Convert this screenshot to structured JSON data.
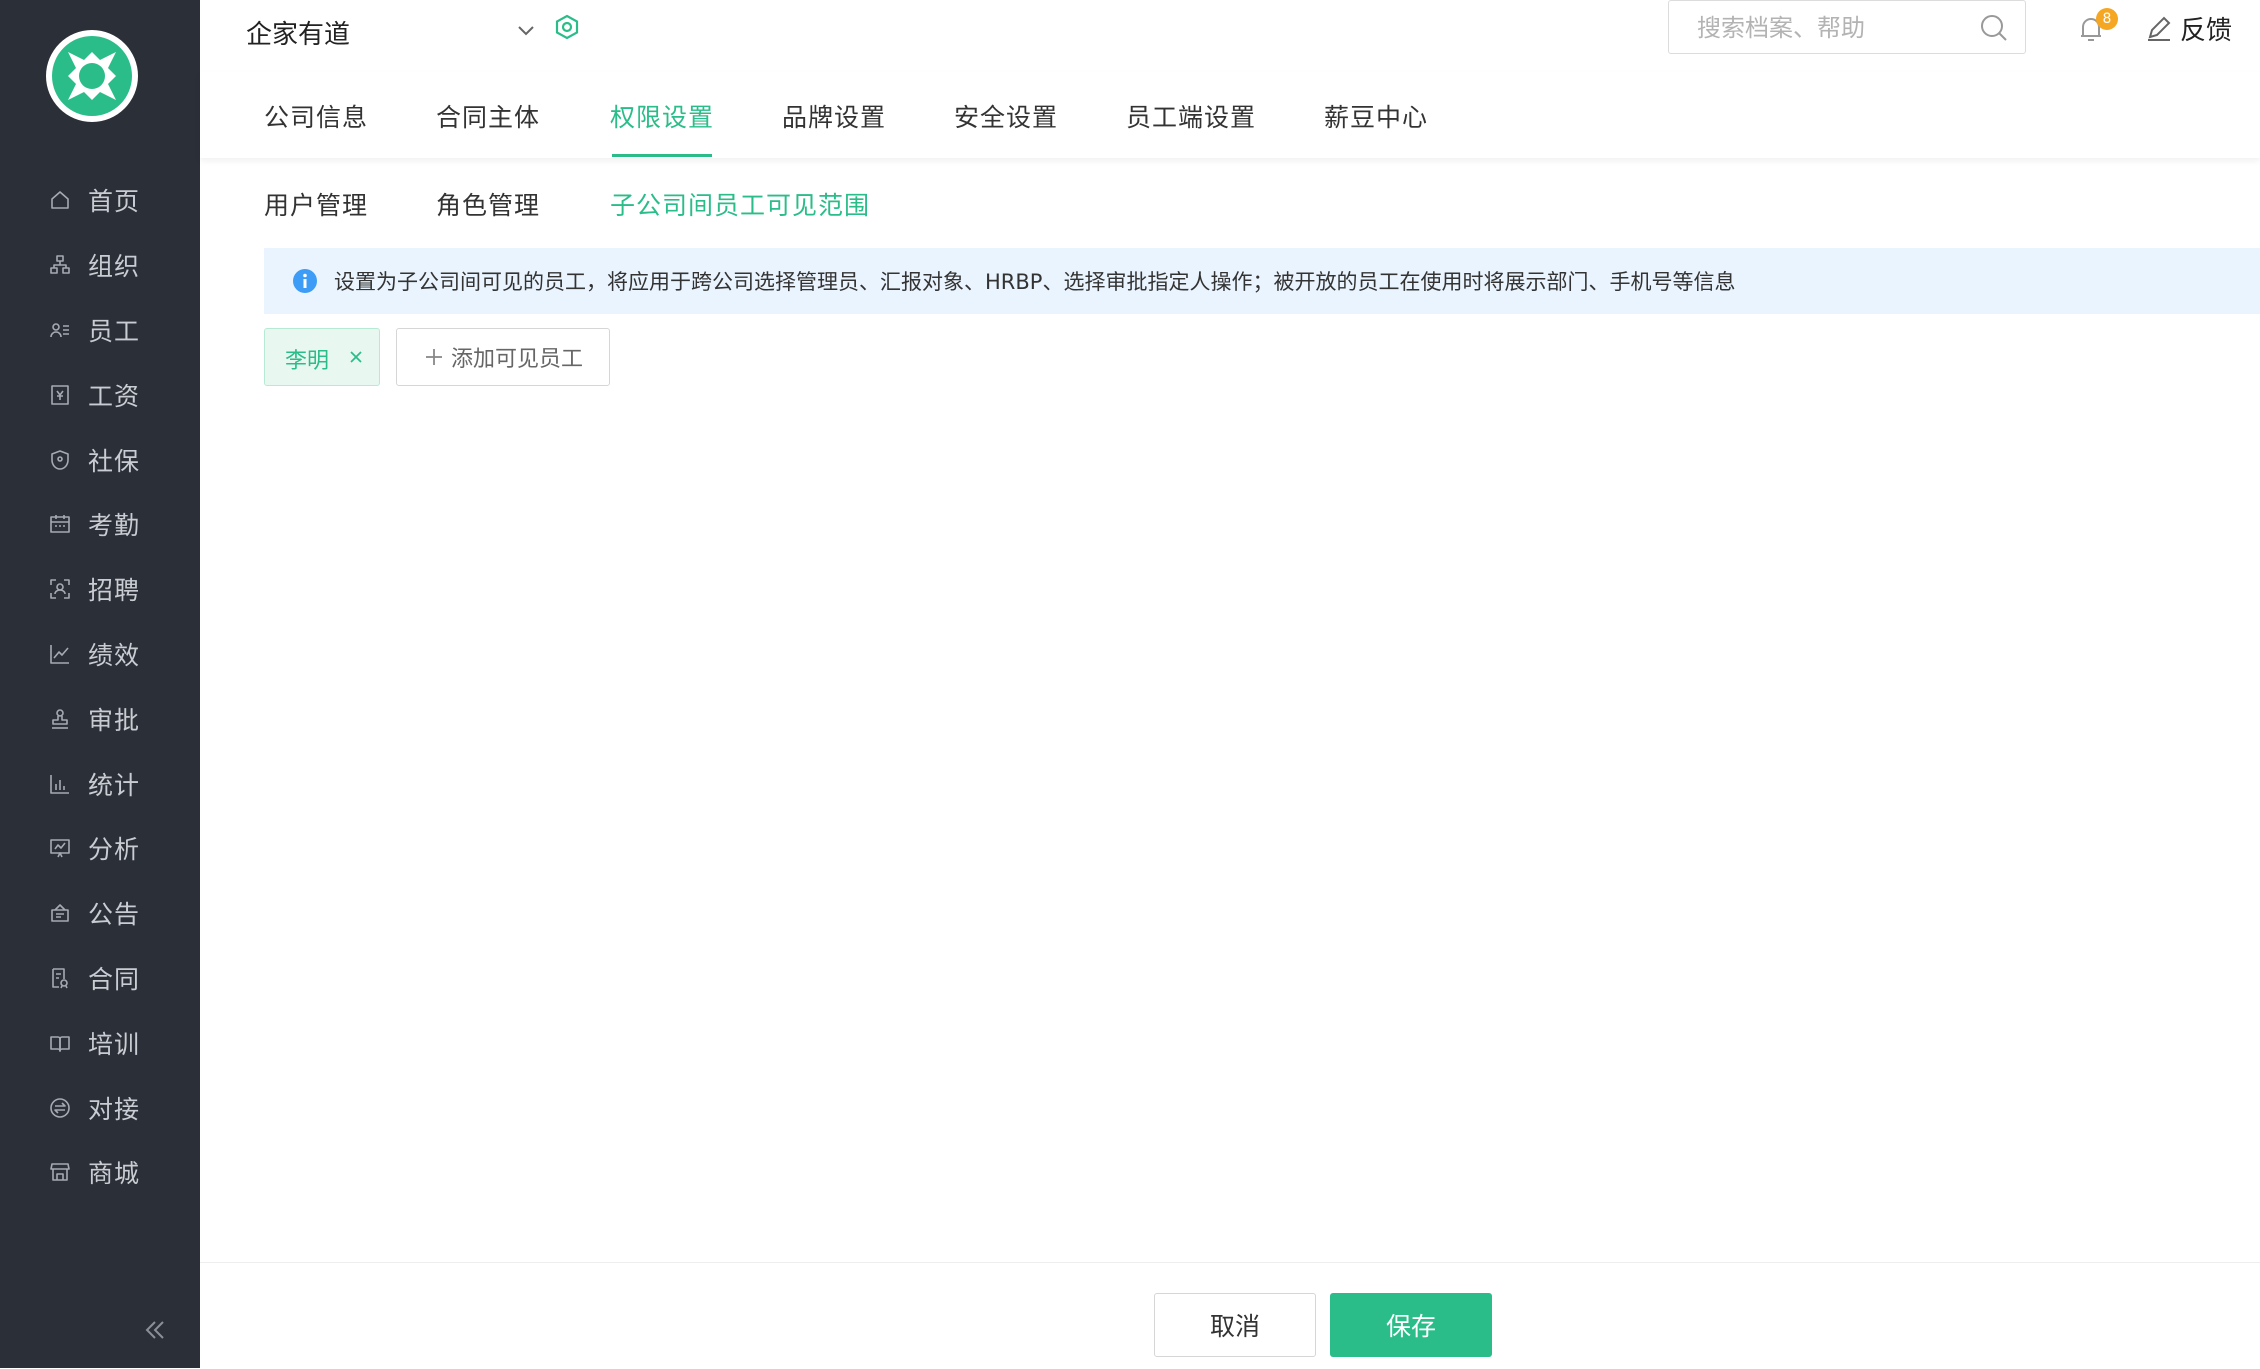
{
  "sidebar": {
    "items": [
      {
        "label": "首页",
        "icon": "home-icon"
      },
      {
        "label": "组织",
        "icon": "org-icon"
      },
      {
        "label": "员工",
        "icon": "employee-icon"
      },
      {
        "label": "工资",
        "icon": "salary-icon"
      },
      {
        "label": "社保",
        "icon": "social-security-icon"
      },
      {
        "label": "考勤",
        "icon": "attendance-icon"
      },
      {
        "label": "招聘",
        "icon": "recruit-icon"
      },
      {
        "label": "绩效",
        "icon": "performance-icon"
      },
      {
        "label": "审批",
        "icon": "approval-icon"
      },
      {
        "label": "统计",
        "icon": "statistics-icon"
      },
      {
        "label": "分析",
        "icon": "analysis-icon"
      },
      {
        "label": "公告",
        "icon": "announcement-icon"
      },
      {
        "label": "合同",
        "icon": "contract-icon"
      },
      {
        "label": "培训",
        "icon": "training-icon"
      },
      {
        "label": "对接",
        "icon": "integration-icon"
      },
      {
        "label": "商城",
        "icon": "store-icon"
      }
    ]
  },
  "header": {
    "company": "企家有道",
    "search_placeholder": "搜索档案、帮助",
    "notification_count": "8",
    "feedback_label": "反馈"
  },
  "tabs": [
    {
      "label": "公司信息",
      "active": false
    },
    {
      "label": "合同主体",
      "active": false
    },
    {
      "label": "权限设置",
      "active": true
    },
    {
      "label": "品牌设置",
      "active": false
    },
    {
      "label": "安全设置",
      "active": false
    },
    {
      "label": "员工端设置",
      "active": false
    },
    {
      "label": "薪豆中心",
      "active": false
    }
  ],
  "subtabs": [
    {
      "label": "用户管理",
      "active": false
    },
    {
      "label": "角色管理",
      "active": false
    },
    {
      "label": "子公司间员工可见范围",
      "active": true
    }
  ],
  "info_text": "设置为子公司间可见的员工，将应用于跨公司选择管理员、汇报对象、HRBP、选择审批指定人操作；被开放的员工在使用时将展示部门、手机号等信息",
  "visible_employees": [
    "李明"
  ],
  "add_button_label": "添加可见员工",
  "footer": {
    "cancel_label": "取消",
    "save_label": "保存"
  },
  "colors": {
    "accent": "#2bbd89",
    "sidebar_bg": "#2b2f37",
    "info_bg": "#eaf4fe",
    "info_icon": "#3d9cf5",
    "badge": "#f5a623"
  }
}
